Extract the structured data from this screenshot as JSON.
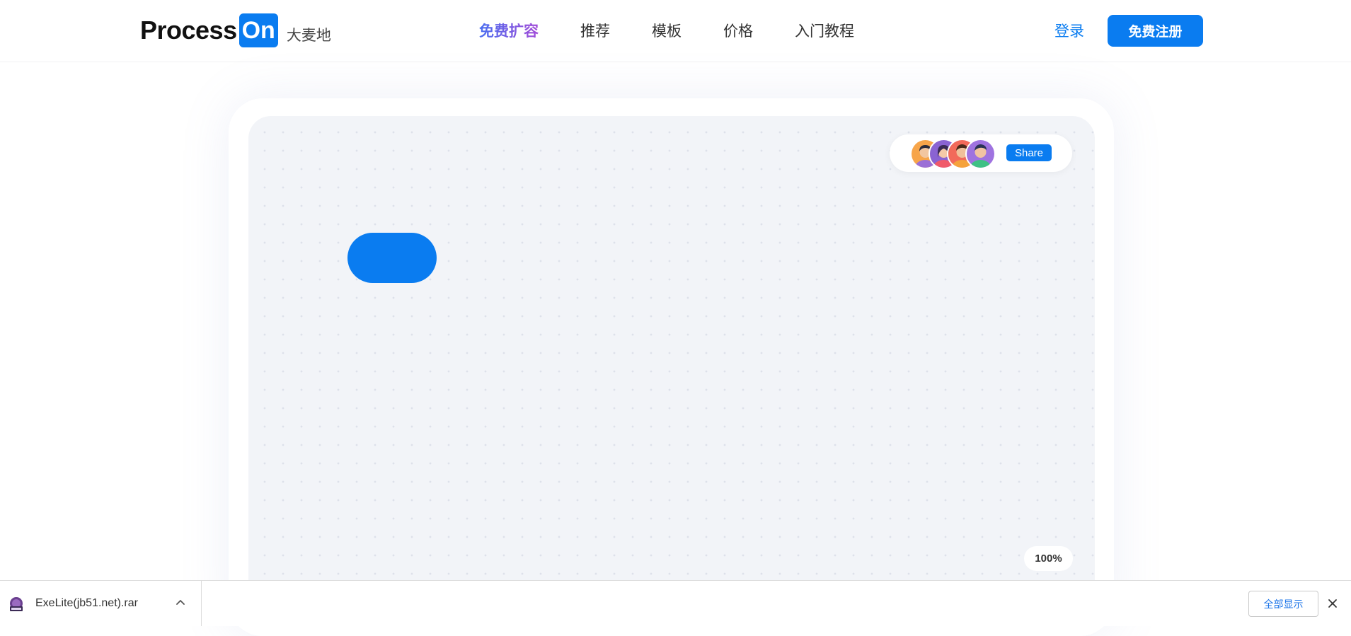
{
  "header": {
    "logo": {
      "text": "Process",
      "badge": "On",
      "sub": "大麦地"
    },
    "nav": [
      {
        "label": "免费扩容",
        "active": true
      },
      {
        "label": "推荐"
      },
      {
        "label": "模板"
      },
      {
        "label": "价格"
      },
      {
        "label": "入门教程"
      }
    ],
    "login_label": "登录",
    "signup_label": "免费注册"
  },
  "hero": {
    "share_label": "Share",
    "zoom_level": "100%",
    "avatars": [
      "avatar-1",
      "avatar-2",
      "avatar-3",
      "avatar-4"
    ]
  },
  "download_bar": {
    "file_name": "ExeLite(jb51.net).rar",
    "file_icon": "rar-archive-icon",
    "show_all_label": "全部显示"
  },
  "colors": {
    "accent": "#0a7cf0",
    "canvas_bg": "#f2f4f8",
    "nav_gradient_start": "#4a6ff0",
    "nav_gradient_end": "#a24bd8"
  }
}
